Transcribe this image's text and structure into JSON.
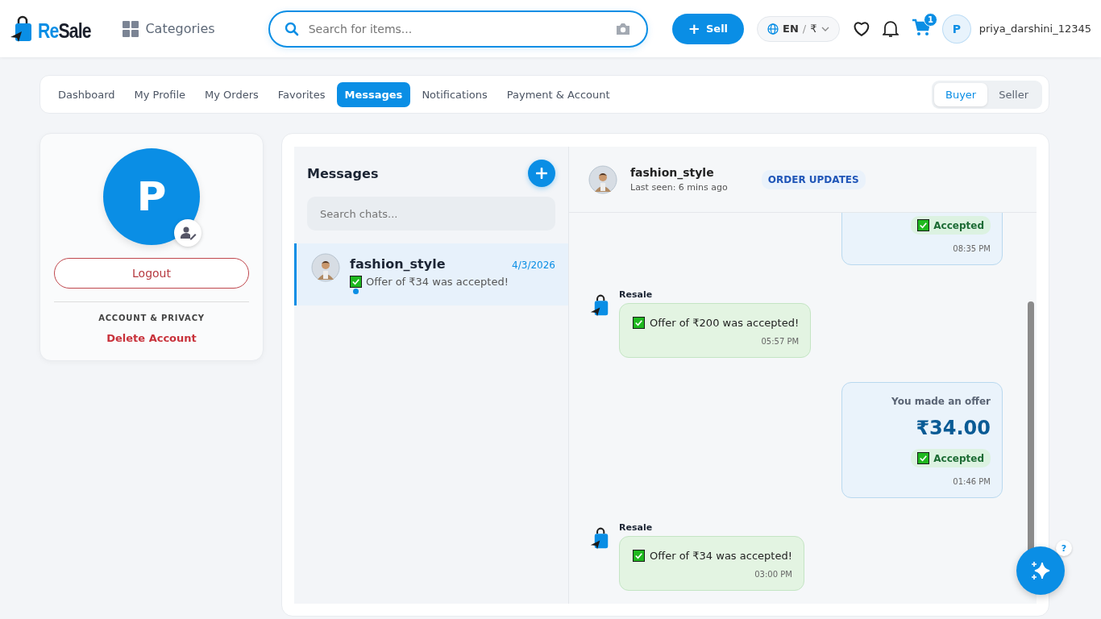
{
  "header": {
    "logo": {
      "part_1": "Re",
      "part_2": "Sale"
    },
    "categories": "Categories",
    "search": {
      "placeholder": "Search for items..."
    },
    "sell_button": "Sell",
    "sell_icon": "+",
    "language": "EN",
    "separator": "/",
    "currency": "₹",
    "cart_count": "1",
    "user": {
      "initial": "P",
      "name": "priya_darshini_12345"
    }
  },
  "tabs": [
    {
      "label": "Dashboard",
      "selected": false
    },
    {
      "label": "My Profile",
      "selected": false
    },
    {
      "label": "My Orders",
      "selected": false
    },
    {
      "label": "Favorites",
      "selected": false
    },
    {
      "label": "Messages",
      "selected": true
    },
    {
      "label": "Notifications",
      "selected": false
    },
    {
      "label": "Payment & Account",
      "selected": false
    }
  ],
  "role_toggle": [
    {
      "label": "Buyer",
      "selected": true
    },
    {
      "label": "Seller",
      "selected": false
    }
  ],
  "profile": {
    "initial": "P",
    "logout": "Logout",
    "section_title": "ACCOUNT & PRIVACY",
    "delete": "Delete Account"
  },
  "chat_list": {
    "title": "Messages",
    "search": {
      "placeholder": "Search chats..."
    },
    "chats": [
      {
        "name": "fashion_style",
        "date": "4/3/2026",
        "preview": "Offer of ₹34 was accepted!",
        "unread": true,
        "selected": true
      }
    ]
  },
  "conversation": {
    "name": "fashion_style",
    "last_seen": "Last seen: 6 mins ago",
    "tag": "ORDER UPDATES",
    "messages": [
      {
        "kind": "offer",
        "status": "Accepted",
        "time": "08:35 PM"
      },
      {
        "kind": "system",
        "sender": "Resale",
        "text": "Offer of ₹200 was accepted!",
        "time": "05:57 PM"
      },
      {
        "kind": "offer",
        "label": "You made an offer",
        "amount": "₹34.00",
        "status": "Accepted",
        "time": "01:46 PM"
      },
      {
        "kind": "system",
        "sender": "Resale",
        "text": "Offer of ₹34 was accepted!",
        "time": "03:00 PM"
      }
    ]
  },
  "help_badge": "?"
}
